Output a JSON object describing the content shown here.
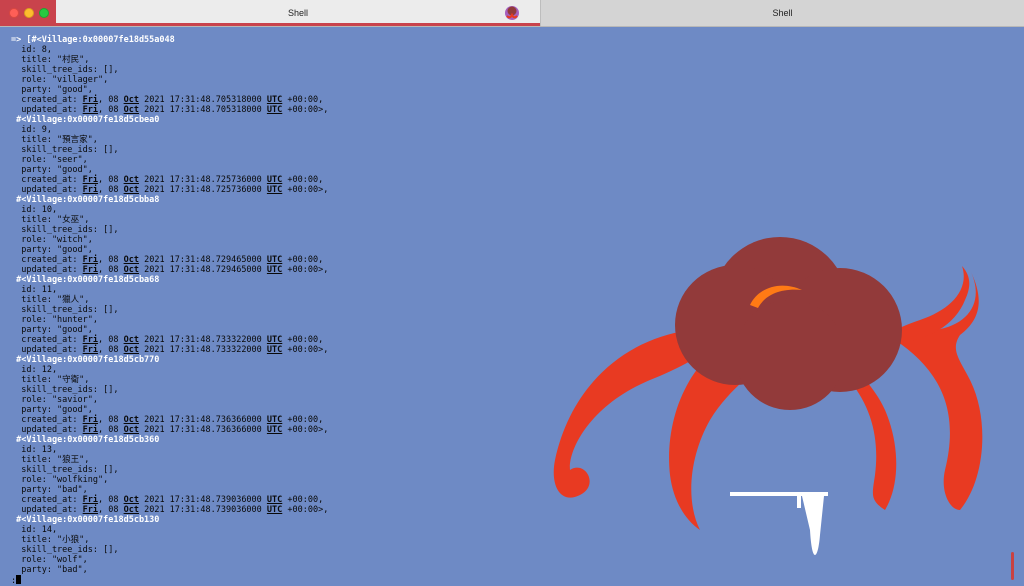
{
  "window": {
    "tabs": [
      {
        "label": "Shell",
        "active": true
      },
      {
        "label": "Shell",
        "active": false
      }
    ]
  },
  "terminal": {
    "prompt": "=>",
    "records": [
      {
        "header": "[#<Village:0x00007fe18d55a048",
        "id": "id: 8,",
        "title": "title: \"村民\",",
        "skills": "skill_tree_ids: [],",
        "role": "role: \"villager\",",
        "party": "party: \"good\",",
        "created": "created_at: Fri, 08 Oct 2021 17:31:48.705318000 UTC +00:00,",
        "updated": "updated_at: Fri, 08 Oct 2021 17:31:48.705318000 UTC +00:00>,"
      },
      {
        "header": "#<Village:0x00007fe18d5cbea0",
        "id": "id: 9,",
        "title": "title: \"預言家\",",
        "skills": "skill_tree_ids: [],",
        "role": "role: \"seer\",",
        "party": "party: \"good\",",
        "created": "created_at: Fri, 08 Oct 2021 17:31:48.725736000 UTC +00:00,",
        "updated": "updated_at: Fri, 08 Oct 2021 17:31:48.725736000 UTC +00:00>,"
      },
      {
        "header": "#<Village:0x00007fe18d5cbba8",
        "id": "id: 10,",
        "title": "title: \"女巫\",",
        "skills": "skill_tree_ids: [],",
        "role": "role: \"witch\",",
        "party": "party: \"good\",",
        "created": "created_at: Fri, 08 Oct 2021 17:31:48.729465000 UTC +00:00,",
        "updated": "updated_at: Fri, 08 Oct 2021 17:31:48.729465000 UTC +00:00>,"
      },
      {
        "header": "#<Village:0x00007fe18d5cba68",
        "id": "id: 11,",
        "title": "title: \"獵人\",",
        "skills": "skill_tree_ids: [],",
        "role": "role: \"hunter\",",
        "party": "party: \"good\",",
        "created": "created_at: Fri, 08 Oct 2021 17:31:48.733322000 UTC +00:00,",
        "updated": "updated_at: Fri, 08 Oct 2021 17:31:48.733322000 UTC +00:00>,"
      },
      {
        "header": "#<Village:0x00007fe18d5cb770",
        "id": "id: 12,",
        "title": "title: \"守衛\",",
        "skills": "skill_tree_ids: [],",
        "role": "role: \"savior\",",
        "party": "party: \"good\",",
        "created": "created_at: Fri, 08 Oct 2021 17:31:48.736366000 UTC +00:00,",
        "updated": "updated_at: Fri, 08 Oct 2021 17:31:48.736366000 UTC +00:00>,"
      },
      {
        "header": "#<Village:0x00007fe18d5cb360",
        "id": "id: 13,",
        "title": "title: \"狼王\",",
        "skills": "skill_tree_ids: [],",
        "role": "role: \"wolfking\",",
        "party": "party: \"bad\",",
        "created": "created_at: Fri, 08 Oct 2021 17:31:48.739036000 UTC +00:00,",
        "updated": "updated_at: Fri, 08 Oct 2021 17:31:48.739036000 UTC +00:00>,"
      },
      {
        "header": "#<Village:0x00007fe18d5cb130",
        "id": "id: 14,",
        "title": "title: \"小狼\",",
        "skills": "skill_tree_ids: [],",
        "role": "role: \"wolf\",",
        "party": "party: \"bad\","
      }
    ],
    "cursor_line": ":"
  },
  "colors": {
    "background": "#6e8ac5",
    "tab_accent": "#c9434c",
    "art_body": "#923a3a",
    "art_tentacles": "#e83a22",
    "art_accent": "#ff7a15"
  },
  "icons": {
    "tab_icon": "mascot-icon",
    "art": "octopus-illustration"
  }
}
